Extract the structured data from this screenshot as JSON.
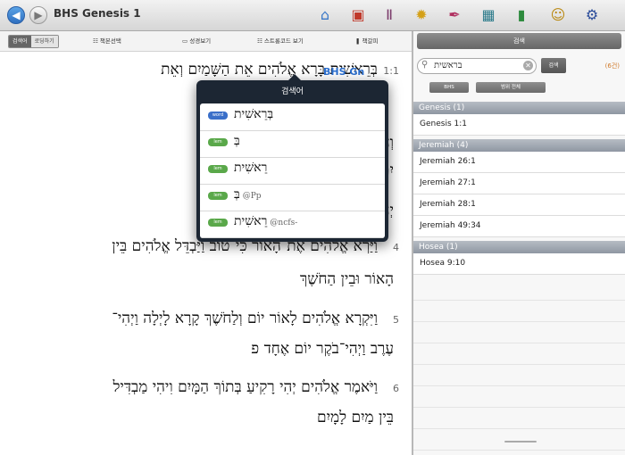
{
  "header": {
    "title": "BHS Genesis 1",
    "back_glyph": "◀",
    "forward_glyph": "▶"
  },
  "toolbar": {
    "icons": [
      {
        "name": "home-icon",
        "glyph": "⌂",
        "color": "#3a78c8"
      },
      {
        "name": "book-icon",
        "glyph": "▣",
        "color": "#c0392b"
      },
      {
        "name": "library-icon",
        "glyph": "Ⅱ",
        "color": "#7a3a6a"
      },
      {
        "name": "sun-icon",
        "glyph": "✹",
        "color": "#d4a017"
      },
      {
        "name": "pen-icon",
        "glyph": "✒",
        "color": "#b03060"
      },
      {
        "name": "image-icon",
        "glyph": "▦",
        "color": "#2a7a8a"
      },
      {
        "name": "note-icon",
        "glyph": "▮",
        "color": "#2e8b3e"
      },
      {
        "name": "user-icon",
        "glyph": "☺",
        "color": "#b8860b"
      },
      {
        "name": "gear-icon",
        "glyph": "⚙",
        "color": "#2b4c9a"
      }
    ]
  },
  "subtoolbar": {
    "seg_labels": [
      "검색어",
      "로딩하기"
    ],
    "items": [
      {
        "icon": "☷",
        "label": "책본선택"
      },
      {
        "icon": "▭",
        "label": "성경보기"
      },
      {
        "icon": "☷",
        "label": "스트롱코드 보기"
      },
      {
        "icon": "❚",
        "label": "책갈피"
      }
    ]
  },
  "reader": {
    "verse_tag": "BHS Gn",
    "lines": [
      {
        "text": "בְּרֵאשִׁית בָּרָא אֱלֹהִים אֵת הַשָּׁמַיִם וְאֵת",
        "verse": "1:1"
      },
      {
        "text": "וְחֹשֶׁךְ עַל־פְּנֵי תְהוֹם וְרוּחַ",
        "verse": ""
      },
      {
        "text": "יִם",
        "verse": ""
      },
      {
        "text": "יְהִי־אוֹר",
        "verse": ""
      },
      {
        "text": "וַיַּרְא אֱלֹהִים אֶת־הָאוֹר כִּי־טוֹב וַיַּבְדֵּל אֱלֹהִים בֵּין",
        "verse": "4"
      },
      {
        "text": "הָאוֹר וּבֵין הַחֹשֶׁךְ",
        "verse": ""
      },
      {
        "text": "וַיִּקְרָא אֱלֹהִים לָאוֹר יוֹם וְלַחֹשֶׁךְ קָרָא לָיְלָה וַיְהִי־",
        "verse": "5"
      },
      {
        "text": "עֶרֶב וַיְהִי־בֹקֶר יוֹם אֶחָד פ",
        "verse": ""
      },
      {
        "text": "וַיֹּאמֶר אֱלֹהִים יְהִי רָקִיעַ בְּתוֹךְ הַמָּיִם וִיהִי מַבְדִּיל",
        "verse": "6"
      },
      {
        "text": "בֵּין מַיִם לָמָיִם",
        "verse": ""
      }
    ]
  },
  "right_panel": {
    "header_label": "검색",
    "search_value": "בראשית",
    "search_button": "검색",
    "count": "(6건)",
    "mini_buttons": [
      "BHS",
      "범위 전체"
    ],
    "groups": [
      {
        "label": "Genesis (1)",
        "items": [
          "Genesis 1:1"
        ]
      },
      {
        "label": "Jeremiah (4)",
        "items": [
          "Jeremiah 26:1",
          "Jeremiah 27:1",
          "Jeremiah 28:1",
          "Jeremiah 49:34"
        ]
      },
      {
        "label": "Hosea (1)",
        "items": [
          "Hosea 9:10"
        ]
      }
    ]
  },
  "popover": {
    "title": "검색어",
    "rows": [
      {
        "badge": "word",
        "text": "בְּרֵאשִׁית",
        "suffix": "",
        "badge_color": "#3a6fc9"
      },
      {
        "badge": "lem",
        "text": "בְּ",
        "suffix": "",
        "badge_color": "#5aa84a"
      },
      {
        "badge": "lem",
        "text": "רֵאשִׁית",
        "suffix": "",
        "badge_color": "#5aa84a"
      },
      {
        "badge": "lem",
        "text": "בְּ",
        "suffix": "@Pp",
        "badge_color": "#5aa84a"
      },
      {
        "badge": "lem",
        "text": "רֵאשִׁית",
        "suffix": "@ncfs-",
        "badge_color": "#5aa84a"
      }
    ]
  }
}
